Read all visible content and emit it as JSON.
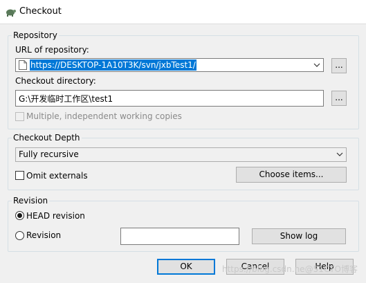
{
  "window": {
    "title": "Checkout"
  },
  "repository": {
    "group_label": "Repository",
    "url_label": "URL of repository:",
    "url_value": "https://DESKTOP-1A10T3K/svn/jxbTest1/",
    "browse_label": "...",
    "dir_label": "Checkout directory:",
    "dir_value": "G:\\开发临时工作区\\test1",
    "dir_browse_label": "...",
    "multiple_label": "Multiple, independent working copies"
  },
  "depth": {
    "group_label": "Checkout Depth",
    "selected": "Fully recursive",
    "omit_externals_label": "Omit externals",
    "choose_items_label": "Choose items..."
  },
  "revision": {
    "group_label": "Revision",
    "head_label": "HEAD revision",
    "revision_label": "Revision",
    "revision_value": "",
    "show_log_label": "Show log"
  },
  "buttons": {
    "ok": "OK",
    "cancel": "Cancel",
    "help": "Help"
  },
  "watermark": "https://blog.csdn.ne@51CTO博客"
}
